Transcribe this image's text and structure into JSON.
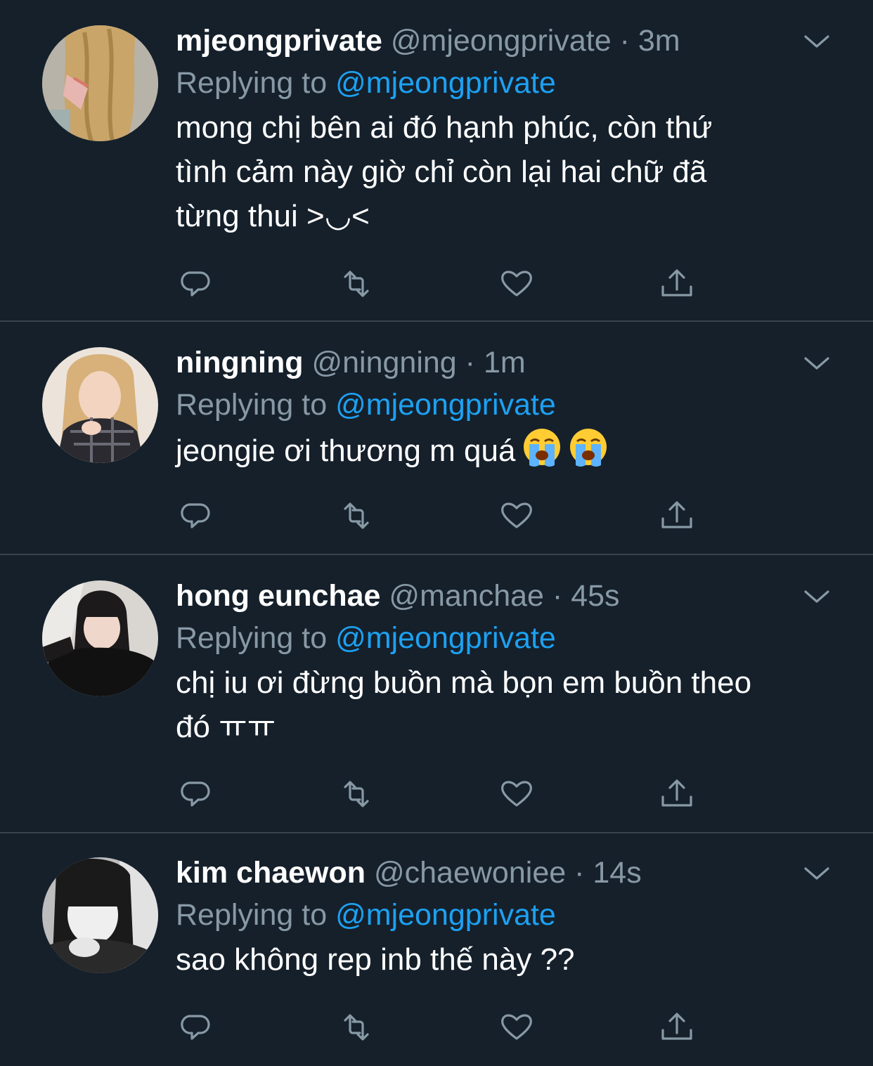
{
  "replying_label": "Replying to",
  "tweets": [
    {
      "name": "mjeongprivate",
      "handle": "@mjeongprivate",
      "separator": "·",
      "time": "3m",
      "reply_to": "@mjeongprivate",
      "text_lines": [
        "mong chị bên ai đó hạnh phúc, còn thứ",
        "tình cảm này giờ chỉ còn lại hai chữ đã",
        "từng thui >◡<"
      ]
    },
    {
      "name": "ningning",
      "handle": "@ningning",
      "separator": "·",
      "time": "1m",
      "reply_to": "@mjeongprivate",
      "text": "jeongie ơi thương m quá",
      "emojis": [
        "loudly-crying-face",
        "loudly-crying-face"
      ]
    },
    {
      "name": "hong eunchae",
      "handle": "@manchae",
      "separator": "·",
      "time": "45s",
      "reply_to": "@mjeongprivate",
      "text_lines": [
        "chị iu ơi đừng buồn mà bọn em buồn theo",
        "đó ㅠㅠ"
      ]
    },
    {
      "name": "kim chaewon",
      "handle": "@chaewoniee",
      "separator": "·",
      "time": "14s",
      "reply_to": "@mjeongprivate",
      "text": "sao không rep inb thế này ??"
    }
  ],
  "icons": {
    "caret": "chevron-down-icon",
    "reply": "reply-icon",
    "retweet": "retweet-icon",
    "like": "heart-icon",
    "share": "share-icon"
  },
  "colors": {
    "background": "#15202b",
    "divider": "#38444d",
    "secondary_text": "#8899a6",
    "accent": "#1da1f2",
    "primary_text": "#ffffff"
  }
}
